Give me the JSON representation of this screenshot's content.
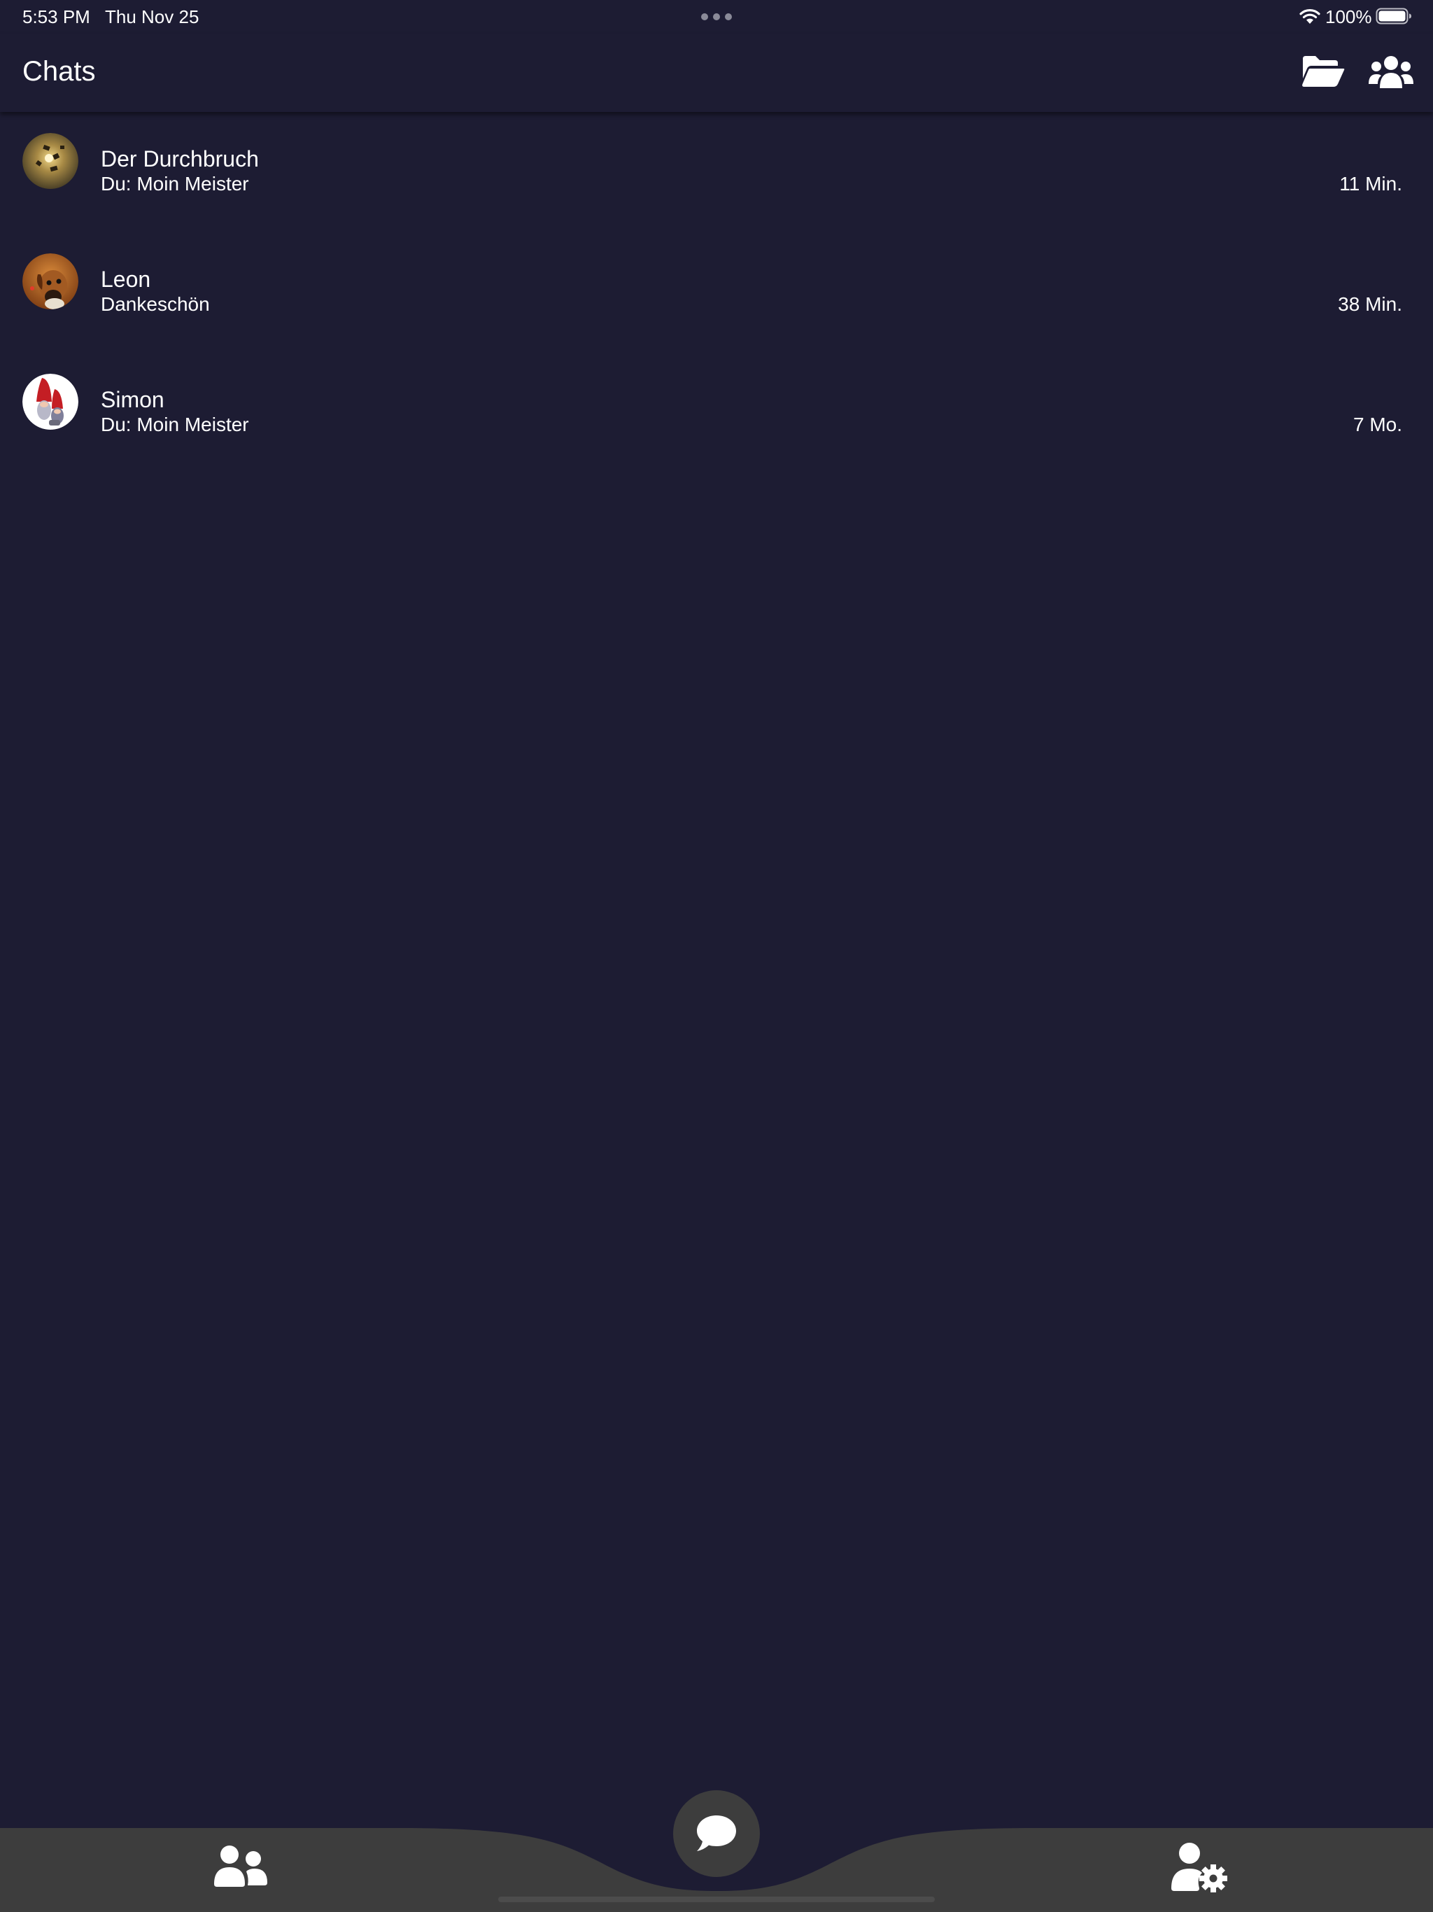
{
  "status_bar": {
    "time": "5:53 PM",
    "date": "Thu Nov 25",
    "battery_percent": "100%",
    "wifi_icon": "wifi-icon",
    "battery_icon": "battery-icon"
  },
  "app_bar": {
    "title": "Chats",
    "actions": [
      {
        "icon": "folder-open-icon"
      },
      {
        "icon": "users-icon"
      }
    ]
  },
  "chats": [
    {
      "name": "Der Durchbruch",
      "preview": "Du: Moin Meister",
      "time": "11 Min.",
      "avatar": "golden-sparks-avatar"
    },
    {
      "name": "Leon",
      "preview": "Dankeschön",
      "time": "38 Min.",
      "avatar": "dog-avatar"
    },
    {
      "name": "Simon",
      "preview": "Du: Moin Meister",
      "time": "7 Mo.",
      "avatar": "gnome-avatar"
    }
  ],
  "bottom_nav": {
    "left_icon": "contacts-icon",
    "center_icon": "chat-bubble-icon",
    "right_icon": "user-settings-icon"
  },
  "colors": {
    "background": "#1d1c33",
    "nav_bar": "#3d3d3d",
    "text": "#ffffff"
  }
}
